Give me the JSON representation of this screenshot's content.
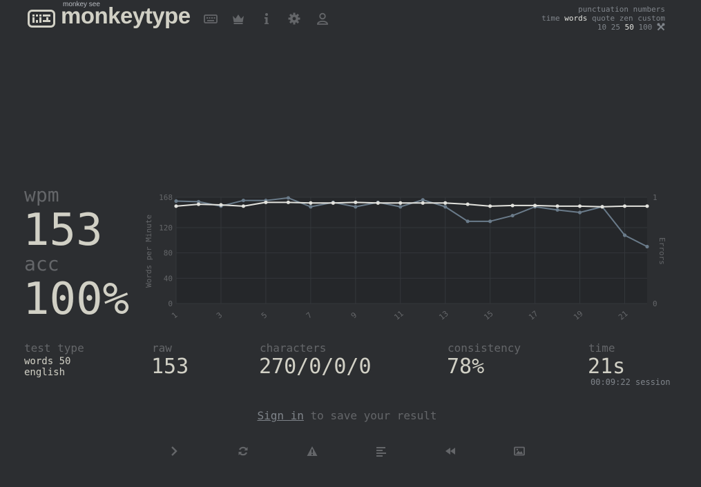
{
  "brand": {
    "tagline": "monkey see",
    "name": "monkeytype"
  },
  "nav": [
    {
      "name": "keyboard-icon"
    },
    {
      "name": "crown-icon"
    },
    {
      "name": "info-icon"
    },
    {
      "name": "gear-icon"
    },
    {
      "name": "user-icon"
    }
  ],
  "config": {
    "row1": [
      "punctuation",
      "numbers"
    ],
    "row2": [
      "time",
      "words",
      "quote",
      "zen",
      "custom"
    ],
    "row2_active": "words",
    "row3": [
      "10",
      "25",
      "50",
      "100"
    ],
    "row3_active": "50",
    "tool_icon": "wrench-icon"
  },
  "stats": {
    "wpm_label": "wpm",
    "wpm": "153",
    "acc_label": "acc",
    "acc": "100%",
    "test_type_label": "test type",
    "test_type_line1": "words 50",
    "test_type_line2": "english",
    "raw_label": "raw",
    "raw": "153",
    "characters_label": "characters",
    "characters": "270/0/0/0",
    "consistency_label": "consistency",
    "consistency": "78%",
    "time_label": "time",
    "time": "21s",
    "session": "00:09:22 session"
  },
  "signin": {
    "link": "Sign in",
    "rest": " to save your result"
  },
  "bottom_buttons": [
    {
      "name": "next-test-button",
      "icon": "chevron-right-icon"
    },
    {
      "name": "restart-button",
      "icon": "refresh-icon"
    },
    {
      "name": "report-button",
      "icon": "warning-icon"
    },
    {
      "name": "words-history-button",
      "icon": "align-left-icon"
    },
    {
      "name": "replay-button",
      "icon": "rewind-icon"
    },
    {
      "name": "screenshot-button",
      "icon": "image-icon"
    }
  ],
  "colors": {
    "background": "#2c2e31",
    "main": "#d1d0c5",
    "sub": "#646669",
    "line_wpm": "#e2e2dd",
    "line_raw": "#6a7b8a"
  },
  "chart_data": {
    "type": "line",
    "x": [
      1,
      2,
      3,
      4,
      5,
      6,
      7,
      8,
      9,
      10,
      11,
      12,
      13,
      14,
      15,
      16,
      17,
      18,
      19,
      20,
      21,
      22
    ],
    "x_ticks": [
      "1",
      "3",
      "5",
      "7",
      "9",
      "11",
      "13",
      "15",
      "17",
      "19",
      "21"
    ],
    "ylabel": "Words per Minute",
    "y2label": "Errors",
    "ylim": [
      0,
      168
    ],
    "y_ticks": [
      "0",
      "40",
      "80",
      "120",
      "168"
    ],
    "y2lim": [
      0,
      1
    ],
    "y2_ticks": [
      "0",
      "1"
    ],
    "grid": true,
    "series": [
      {
        "key": "wpm",
        "values": [
          154,
          157,
          156,
          154,
          160,
          160,
          159,
          159,
          160,
          159,
          159,
          159,
          159,
          157,
          154,
          155,
          155,
          154,
          154,
          153,
          154,
          154
        ]
      },
      {
        "key": "raw",
        "values": [
          162,
          161,
          154,
          163,
          163,
          167,
          153,
          160,
          153,
          160,
          153,
          164,
          153,
          130,
          130,
          139,
          153,
          148,
          144,
          153,
          108,
          90
        ]
      }
    ]
  }
}
